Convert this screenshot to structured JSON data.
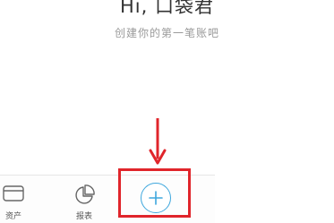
{
  "header": {
    "greeting": "Hi, 口袋君",
    "subtitle": "创建你的第一笔账吧"
  },
  "tabbar": {
    "items": [
      {
        "label": "资产",
        "icon": "wallet-icon"
      },
      {
        "label": "报表",
        "icon": "pie-chart-icon"
      }
    ],
    "add_icon": "plus-icon"
  },
  "annotation": {
    "arrow_color": "#e0252b",
    "box_color": "#e0252b"
  },
  "colors": {
    "accent": "#3ea7dd",
    "annotation_red": "#e0252b",
    "text_primary": "#333333",
    "text_secondary": "#9a9a9a"
  }
}
